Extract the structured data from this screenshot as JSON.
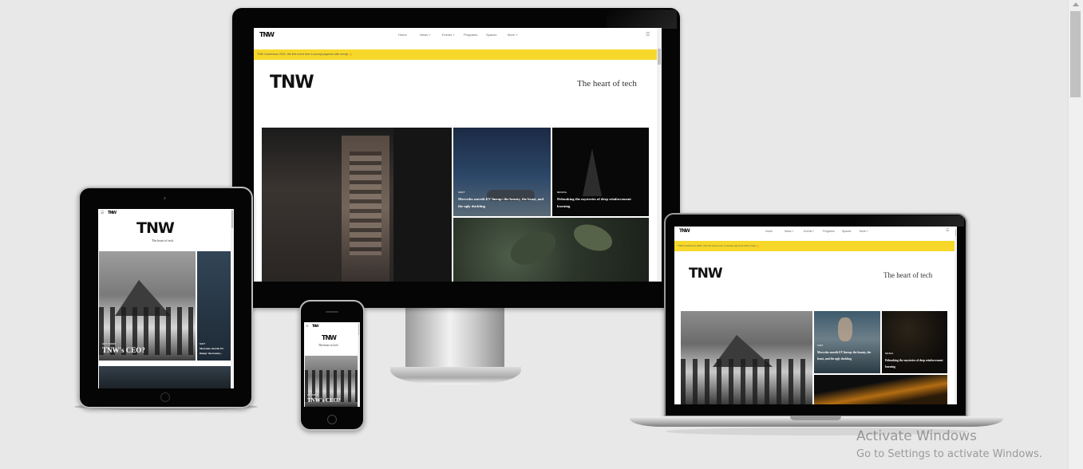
{
  "brand": {
    "logo": "TNW",
    "tagline": "The heart of tech"
  },
  "nav": {
    "items": [
      "Home",
      "News ˅",
      "Events ˅",
      "Programs",
      "Spaces",
      "More ˅"
    ]
  },
  "banner": {
    "text": "TNW Conference 2021: the first event ever to accept payment with emojis 👍"
  },
  "articles": {
    "a1": {
      "category": "SHIFT",
      "title": "Mercedes unveils EV lineup: the beauty, the beast, and the ugly duckling"
    },
    "a2": {
      "category": "NEURAL",
      "title": "Debunking the mysteries of deep reinforcement learning"
    },
    "feature": {
      "category": "HOT TAKES",
      "title": "TNW's CEO?"
    },
    "tablet_side": {
      "category": "SHIFT",
      "title": "Mercedes unveils EV lineup: the beauty..."
    }
  },
  "watermark": {
    "title": "Activate Windows",
    "subtitle": "Go to Settings to activate Windows."
  },
  "colors": {
    "background": "#e8e8e8",
    "banner": "#f7d82a",
    "bezel": "#050505"
  }
}
